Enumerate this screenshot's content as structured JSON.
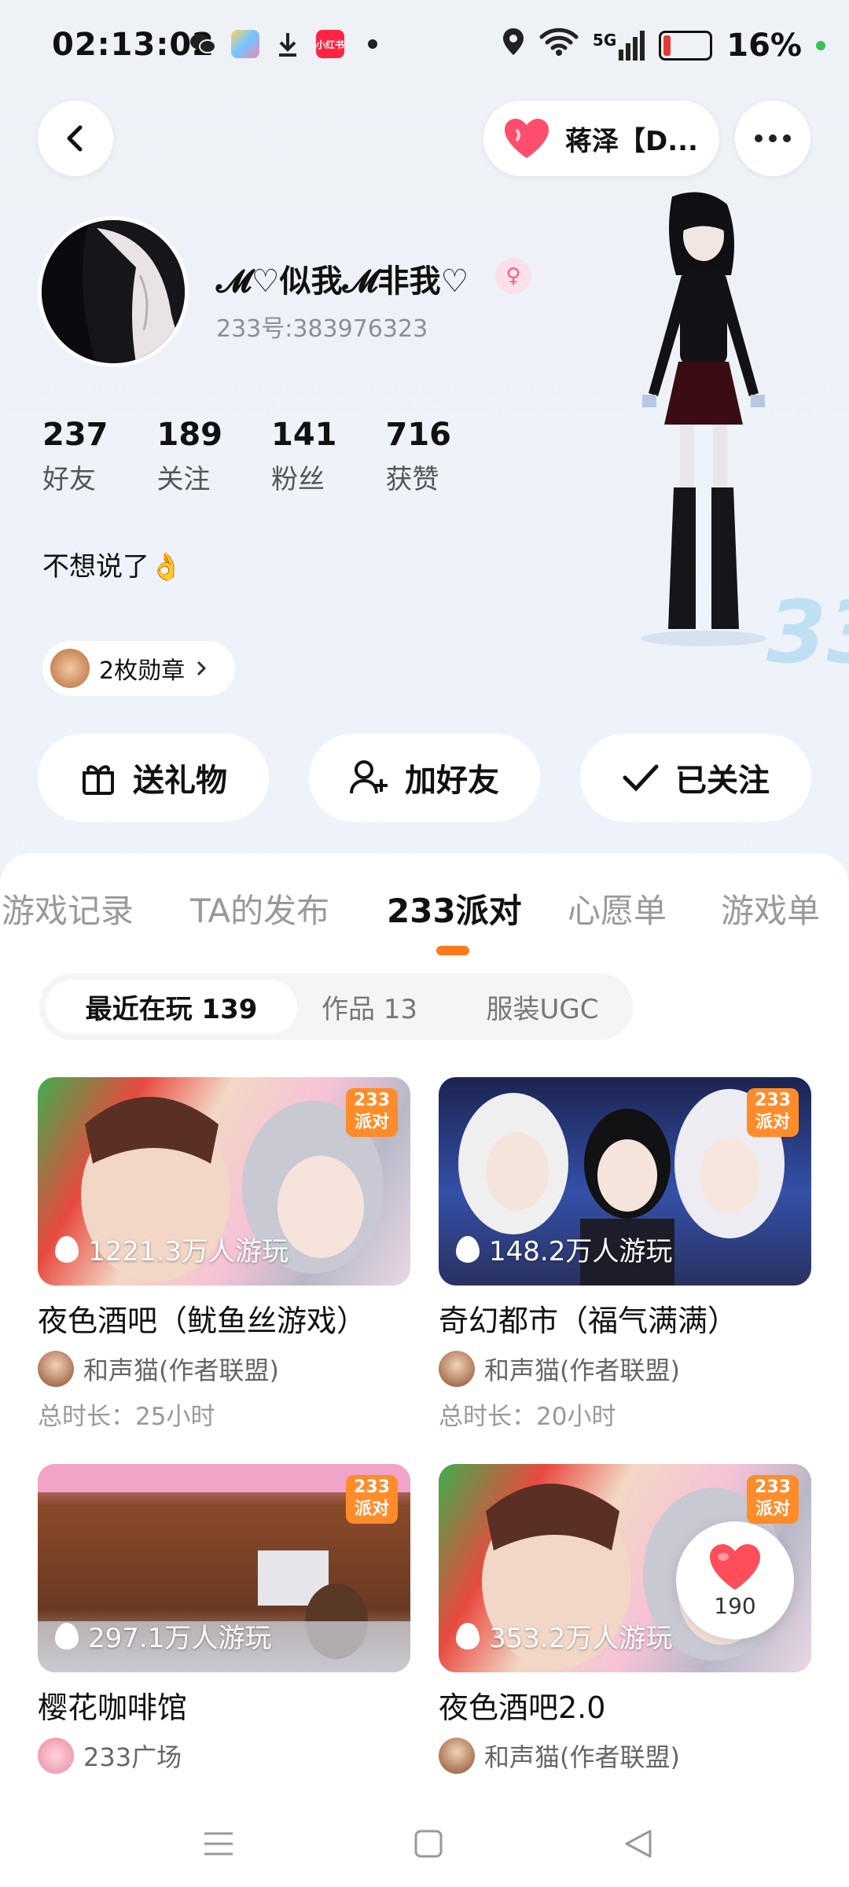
{
  "status_bar": {
    "time": "02:13:02",
    "network": "5G",
    "battery": "16%",
    "battery_level": 0.16,
    "left_icons": [
      "wechat-icon",
      "app-icon",
      "download-icon",
      "xiaohongshu-icon",
      "dot-icon"
    ],
    "right_icons": [
      "location-icon",
      "wifi-icon",
      "signal-icon",
      "battery-icon"
    ]
  },
  "header": {
    "friend_name": "蒋泽【D...",
    "friend_icon": "heart-icon"
  },
  "profile": {
    "username": "𝓜♡似我𝓜非我♡",
    "uid": "233号:383976323",
    "gender_icon": "female-icon",
    "stats": [
      {
        "num": "237",
        "label": "好友"
      },
      {
        "num": "189",
        "label": "关注"
      },
      {
        "num": "141",
        "label": "粉丝"
      },
      {
        "num": "716",
        "label": "获赞"
      }
    ],
    "bio": "不想说了👌",
    "medals": "2枚勋章"
  },
  "actions": {
    "gift": "送礼物",
    "add_friend": "加好友",
    "followed": "已关注"
  },
  "tabs": [
    "游戏记录",
    "TA的发布",
    "233派对",
    "心愿单",
    "游戏单"
  ],
  "active_tab": "233派对",
  "subtabs": [
    "最近在玩 139",
    "作品 13",
    "服装UGC"
  ],
  "badge": {
    "line1": "233",
    "line2": "派对"
  },
  "cards": [
    {
      "title": "夜色酒吧（鱿鱼丝游戏）",
      "plays": "1221.3万人游玩",
      "author": "和声猫(作者联盟)",
      "duration": "总时长：25小时"
    },
    {
      "title": "奇幻都市（福气满满）",
      "plays": "148.2万人游玩",
      "author": "和声猫(作者联盟)",
      "duration": "总时长：20小时"
    },
    {
      "title": "樱花咖啡馆",
      "plays": "297.1万人游玩",
      "author": "233广场",
      "duration": ""
    },
    {
      "title": "夜色酒吧2.0",
      "plays": "353.2万人游玩",
      "author": "和声猫(作者联盟)",
      "duration": ""
    }
  ],
  "like_fab": {
    "count": "190"
  },
  "colors": {
    "accent": "#ff7a1a",
    "heart": "#ff4d6d",
    "gender": "#f06292"
  }
}
